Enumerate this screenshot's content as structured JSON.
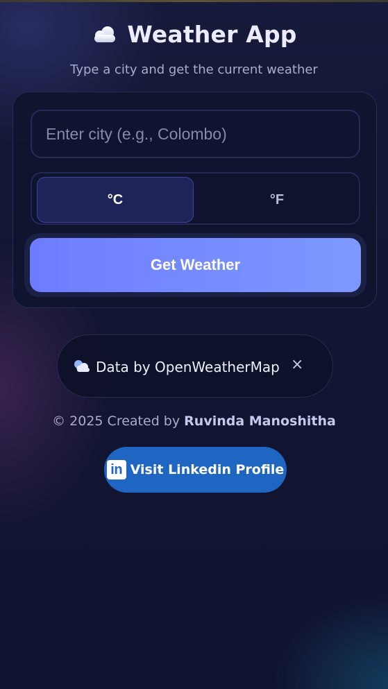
{
  "header": {
    "icon": "cloud-icon",
    "title": "Weather App",
    "subtitle": "Type a city and get the current weather"
  },
  "search": {
    "placeholder": "Enter city (e.g., Colombo)",
    "value": ""
  },
  "units": {
    "celsius_label": "°C",
    "fahrenheit_label": "°F",
    "selected": "°C"
  },
  "actions": {
    "get_weather_label": "Get Weather"
  },
  "data_source": {
    "icon": "sun-cloud-icon",
    "label": "Data by OpenWeatherMap",
    "close": "×"
  },
  "footer": {
    "credit_prefix": "© 2025 Created by",
    "author": "Ruvinda Manoshitha",
    "linkedin_icon_text": "in",
    "linkedin_label": "Visit Linkedin Profile"
  },
  "colors": {
    "accent": "#7b8cff",
    "linkedin": "#1f66c2",
    "background": "#121633"
  }
}
